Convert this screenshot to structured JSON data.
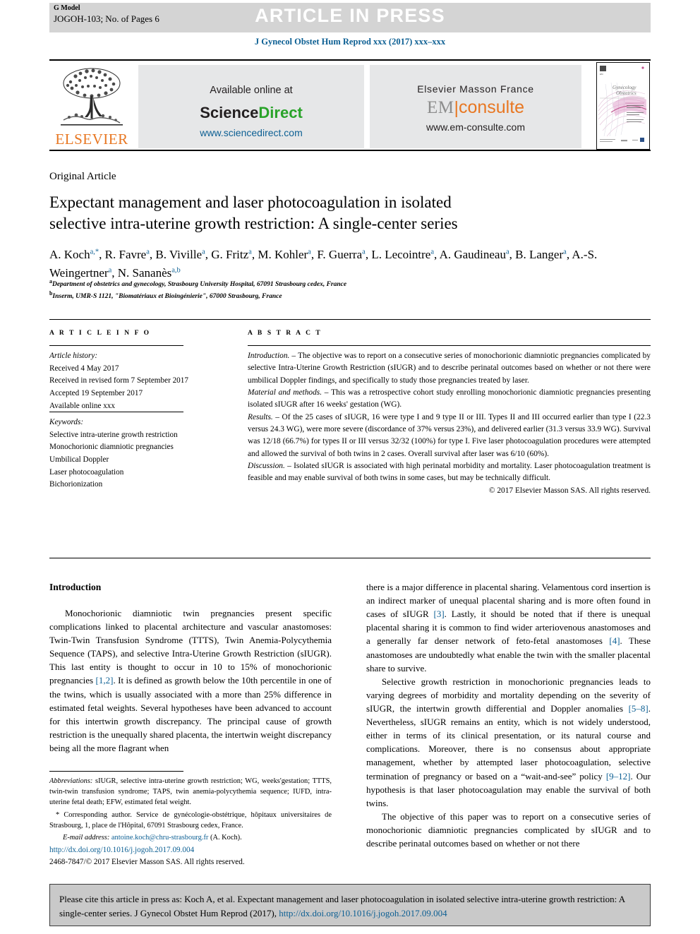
{
  "header": {
    "g_model_label": "G Model",
    "manuscript_id": "JOGOH-103; No. of Pages 6",
    "article_in_press": "ARTICLE IN PRESS",
    "journal_line": "J Gynecol Obstet Hum Reprod xxx (2017) xxx–xxx"
  },
  "masthead": {
    "publisher_logo": "ELSEVIER",
    "available_online": "Available online at",
    "sciencedirect_sci": "Science",
    "sciencedirect_direct": "Direct",
    "sciencedirect_url": "www.sciencedirect.com",
    "em_publisher": "Elsevier Masson France",
    "em_logo_em": "EM",
    "em_logo_bar": "|",
    "em_logo_consulte": "consulte",
    "em_url": "www.em-consulte.com",
    "cover_title_line1": "Gynecology",
    "cover_title_line2": "Obstetrics"
  },
  "article": {
    "kicker": "Original Article",
    "title_line1": "Expectant management and laser photocoagulation in isolated",
    "title_line2": "selective intra-uterine growth restriction: A single-center series",
    "authors": [
      {
        "name": "A. Koch",
        "sup": "a,*"
      },
      {
        "name": "R. Favre",
        "sup": "a"
      },
      {
        "name": "B. Viville",
        "sup": "a"
      },
      {
        "name": "G. Fritz",
        "sup": "a"
      },
      {
        "name": "M. Kohler",
        "sup": "a"
      },
      {
        "name": "F. Guerra",
        "sup": "a"
      },
      {
        "name": "L. Lecointre",
        "sup": "a"
      },
      {
        "name": "A. Gaudineau",
        "sup": "a"
      },
      {
        "name": "B. Langer",
        "sup": "a"
      },
      {
        "name": "A.-S. Weingertner",
        "sup": "a"
      },
      {
        "name": "N. Sananès",
        "sup": "a,b"
      }
    ],
    "affiliations": [
      {
        "marker": "a",
        "text": "Department of obstetrics and gynecology, Strasbourg University Hospital, 67091 Strasbourg cedex, France"
      },
      {
        "marker": "b",
        "text": "Inserm, UMR-S 1121, \"Biomatériaux et Bioingénierie\", 67000 Strasbourg, France"
      }
    ]
  },
  "info": {
    "label_article_info": "A R T I C L E   I N F O",
    "label_abstract": "A B S T R A C T",
    "history_heading": "Article history:",
    "history": [
      "Received 4 May 2017",
      "Received in revised form 7 September 2017",
      "Accepted 19 September 2017",
      "Available online xxx"
    ],
    "keywords_heading": "Keywords:",
    "keywords": [
      "Selective intra-uterine growth restriction",
      "Monochorionic diamniotic pregnancies",
      "Umbilical Doppler",
      "Laser photocoagulation",
      "Bichorionization"
    ]
  },
  "abstract": {
    "introduction_label": "Introduction. – ",
    "introduction_text": "The objective was to report on a consecutive series of monochorionic diamniotic pregnancies complicated by selective Intra-Uterine Growth Restriction (sIUGR) and to describe perinatal outcomes based on whether or not there were umbilical Doppler findings, and specifically to study those pregnancies treated by laser.",
    "methods_label": "Material and methods. – ",
    "methods_text": "This was a retrospective cohort study enrolling monochorionic diamniotic pregnancies presenting isolated sIUGR after 16 weeks' gestation (WG).",
    "results_label": "Results. – ",
    "results_text": "Of the 25 cases of sIUGR, 16 were type I and 9 type II or III. Types II and III occurred earlier than type I (22.3 versus 24.3 WG), were more severe (discordance of 37% versus 23%), and delivered earlier (31.3 versus 33.9 WG). Survival was 12/18 (66.7%) for types II or III versus 32/32 (100%) for type I. Five laser photocoagulation procedures were attempted and allowed the survival of both twins in 2 cases. Overall survival after laser was 6/10 (60%).",
    "discussion_label": "Discussion. – ",
    "discussion_text": "Isolated sIUGR is associated with high perinatal morbidity and mortality. Laser photocoagulation treatment is feasible and may enable survival of both twins in some cases, but may be technically difficult.",
    "copyright": "© 2017 Elsevier Masson SAS. All rights reserved."
  },
  "body": {
    "section_heading": "Introduction",
    "left_paragraph_1_a": "Monochorionic diamniotic twin pregnancies present specific complications linked to placental architecture and vascular anastomoses: Twin-Twin Transfusion Syndrome (TTTS), Twin Anemia-Polycythemia Sequence (TAPS), and selective Intra-Uterine Growth Restriction (sIUGR). This last entity is thought to occur in 10 to 15% of monochorionic pregnancies ",
    "left_ref_1": "[1,2]",
    "left_paragraph_1_b": ". It is defined as growth below the 10th percentile in one of the twins, which is usually associated with a more than 25% difference in estimated fetal weights. Several hypotheses have been advanced to account for this intertwin growth discrepancy. The principal cause of growth restriction is the unequally shared placenta, the intertwin weight discrepancy being all the more flagrant when",
    "right_paragraph_1_a": "there is a major difference in placental sharing. Velamentous cord insertion is an indirect marker of unequal placental sharing and is more often found in cases of sIUGR ",
    "right_ref_1": "[3]",
    "right_paragraph_1_b": ". Lastly, it should be noted that if there is unequal placental sharing it is common to find wider arteriovenous anastomoses and a generally far denser network of feto-fetal anastomoses ",
    "right_ref_2": "[4]",
    "right_paragraph_1_c": ". These anastomoses are undoubtedly what enable the twin with the smaller placental share to survive.",
    "right_paragraph_2_a": "Selective growth restriction in monochorionic pregnancies leads to varying degrees of morbidity and mortality depending on the severity of sIUGR, the intertwin growth differential and Doppler anomalies ",
    "right_ref_3": "[5–8]",
    "right_paragraph_2_b": ". Nevertheless, sIUGR remains an entity, which is not widely understood, either in terms of its clinical presentation, or its natural course and complications. Moreover, there is no consensus about appropriate management, whether by attempted laser photocoagulation, selective termination of pregnancy or based on a “wait-and-see” policy ",
    "right_ref_4": "[9–12]",
    "right_paragraph_2_c": ". Our hypothesis is that laser photocoagulation may enable the survival of both twins.",
    "right_paragraph_3": "The objective of this paper was to report on a consecutive series of monochorionic diamniotic pregnancies complicated by sIUGR and to describe perinatal outcomes based on whether or not there"
  },
  "footnotes": {
    "abbrev_label": "Abbreviations:",
    "abbrev_text": " sIUGR, selective intra-uterine growth restriction; WG, weeks'gestation; TTTS, twin-twin transfusion syndrome; TAPS, twin anemia-polycythemia sequence; IUFD, intra-uterine fetal death; EFW, estimated fetal weight.",
    "corresponding_marker": "*",
    "corresponding_text": " Corresponding author. Service de gynécologie-obstétrique, hôpitaux universitaires de Strasbourg, 1, place de l'Hôpital, 67091 Strasbourg cedex, France.",
    "email_label": "E-mail address:",
    "email_value": "antoine.koch@chru-strasbourg.fr",
    "email_suffix": " (A. Koch).",
    "doi_url": "http://dx.doi.org/10.1016/j.jogoh.2017.09.004",
    "issn_copyright": "2468-7847/© 2017 Elsevier Masson SAS. All rights reserved."
  },
  "cite_box": {
    "text_before_link": "Please cite this article in press as: Koch A, et al. Expectant management and laser photocoagulation in isolated selective intra-uterine growth restriction: A single-center series. J Gynecol Obstet Hum Reprod (2017), ",
    "link": "http://dx.doi.org/10.1016/j.jogoh.2017.09.004"
  },
  "colors": {
    "link_blue": "#0c5f93",
    "elsevier_orange": "#e87722",
    "sciencedirect_green": "#29a329",
    "banner_gray": "#d4d4d4",
    "panel_gray": "#e6e7e8",
    "cite_gray": "#c9c9c9"
  }
}
